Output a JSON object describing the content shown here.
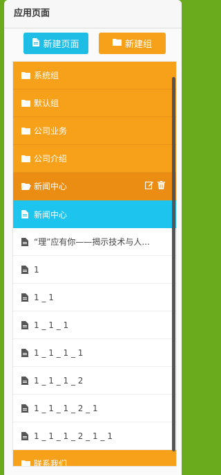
{
  "header": {
    "title": "应用页面"
  },
  "toolbar": {
    "new_page_label": "新建页面",
    "new_group_label": "新建组"
  },
  "list": {
    "groups": [
      "系统组",
      "默认组",
      "公司业务",
      "公司介绍"
    ],
    "open_group": "新闻中心",
    "pages": [
      "新闻中心",
      "“理”应有你——揭示技术与人...",
      "1",
      "1 _ 1",
      "1 _ 1 _ 1",
      "1 _ 1 _ 1 _ 1",
      "1 _ 1 _ 1 _ 2",
      "1 _ 1 _ 1 _ 2 _ 1",
      "1 _ 1 _ 1 _ 2 _ 1 _ 1"
    ],
    "last_group": "联系我们"
  },
  "colors": {
    "orange": "#f7a11b",
    "orange_active": "#ea8d12",
    "cyan": "#1dc4ee",
    "page_bg": "#6aab1e"
  },
  "icons": {
    "folder": "folder-icon",
    "folder_open": "folder-open-icon",
    "file": "file-icon",
    "edit": "edit-icon",
    "trash": "trash-icon"
  }
}
